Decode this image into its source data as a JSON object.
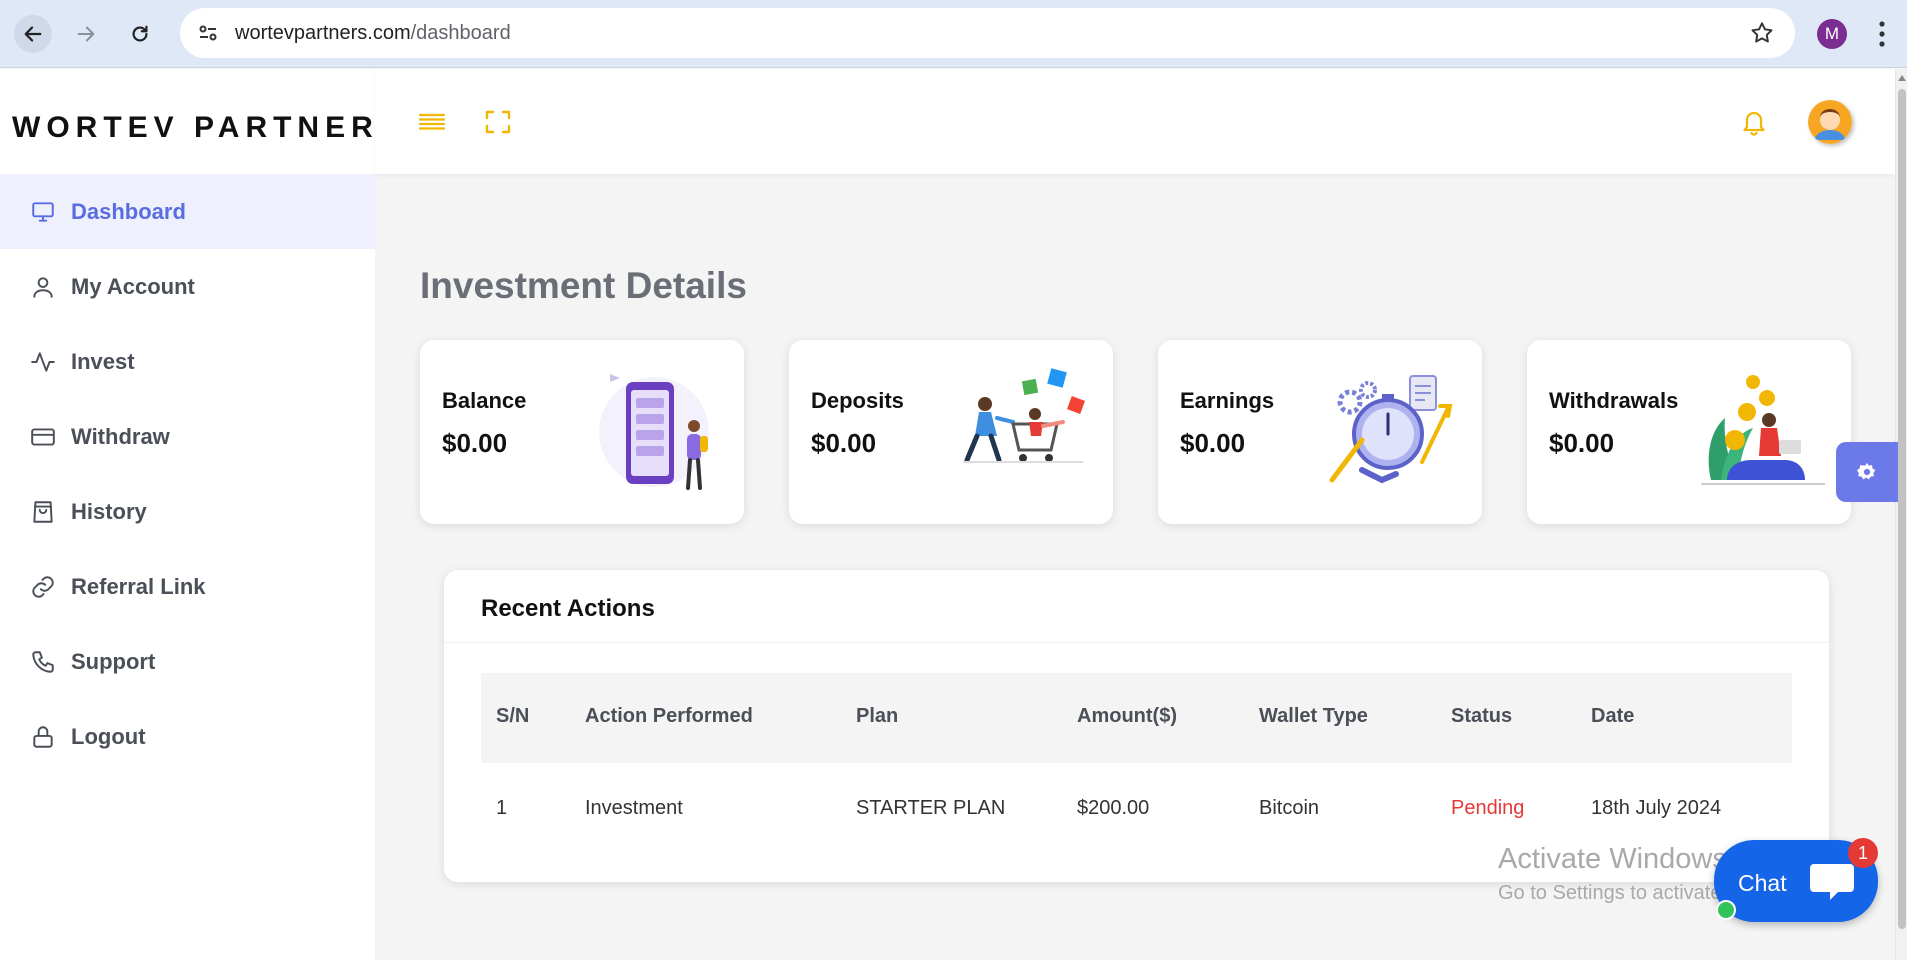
{
  "browser": {
    "url_host": "wortevpartners.com",
    "url_path": "/dashboard",
    "profile_initial": "M"
  },
  "brand": "WORTEV PARTNERS",
  "sidebar": {
    "items": [
      {
        "label": "Dashboard",
        "icon": "monitor-icon",
        "active": true
      },
      {
        "label": "My Account",
        "icon": "user-icon"
      },
      {
        "label": "Invest",
        "icon": "activity-icon"
      },
      {
        "label": "Withdraw",
        "icon": "credit-card-icon"
      },
      {
        "label": "History",
        "icon": "shopping-bag-icon"
      },
      {
        "label": "Referral Link",
        "icon": "link-icon"
      },
      {
        "label": "Support",
        "icon": "phone-icon"
      },
      {
        "label": "Logout",
        "icon": "lock-icon"
      }
    ]
  },
  "main": {
    "title": "Investment Details",
    "cards": [
      {
        "label": "Balance",
        "value": "$0.00"
      },
      {
        "label": "Deposits",
        "value": "$0.00"
      },
      {
        "label": "Earnings",
        "value": "$0.00"
      },
      {
        "label": "Withdrawals",
        "value": "$0.00"
      }
    ],
    "recent": {
      "title": "Recent Actions",
      "headers": [
        "S/N",
        "Action Performed",
        "Plan",
        "Amount($)",
        "Wallet Type",
        "Status",
        "Date"
      ],
      "rows": [
        [
          "1",
          "Investment",
          "STARTER PLAN",
          "$200.00",
          "Bitcoin",
          "Pending",
          "18th July 2024"
        ]
      ]
    }
  },
  "watermark": {
    "line1": "Activate Windows",
    "line2": "Go to Settings to activate Windows."
  },
  "chat": {
    "label": "Chat",
    "badge": "1"
  },
  "colors": {
    "accent": "#5a6de0",
    "brand_yellow": "#f2b705",
    "status_pending": "#e53935",
    "chat_blue": "#1565e8"
  }
}
